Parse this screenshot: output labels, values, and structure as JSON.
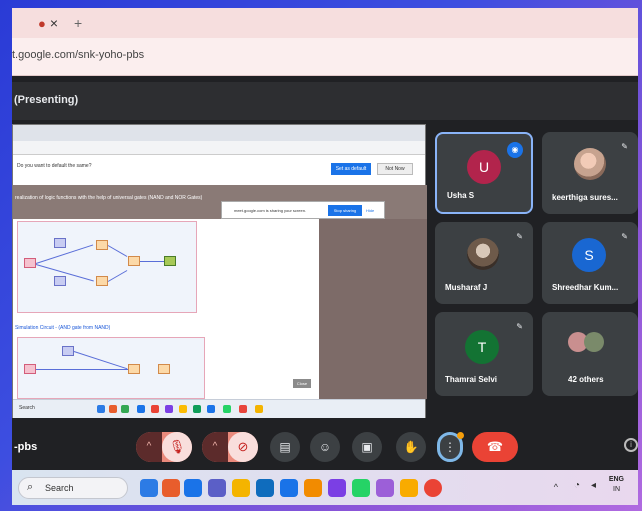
{
  "browser": {
    "tab_close": "×",
    "tab_controls": "●",
    "new_tab": "+",
    "url": "t.google.com/snk-yoho-pbs"
  },
  "meet": {
    "presenting_label": "(Presenting)",
    "meeting_code": "-pbs",
    "participants": [
      {
        "name": "Usha S",
        "initial": "U",
        "avatar_color": "#b2244c",
        "speaking": true
      },
      {
        "name": "keerthiga sures...",
        "initial": "",
        "photo": true
      },
      {
        "name": "Musharaf J",
        "initial": "",
        "photo": true
      },
      {
        "name": "Shreedhar Kum...",
        "initial": "S",
        "avatar_color": "#1967d2"
      },
      {
        "name": "Thamrai Selvi",
        "initial": "T",
        "avatar_color": "#137333"
      },
      {
        "name": "42 others",
        "initial": "",
        "group": true
      }
    ],
    "controls": {
      "caret": "^",
      "mic_icon": "🎙",
      "cam_icon": "⊘",
      "captions_icon": "▤",
      "emoji_icon": "☺",
      "present_icon": "▣",
      "raise_hand_icon": "✋",
      "more_icon": "⋮",
      "leave_icon": "☎",
      "info_icon": "i"
    }
  },
  "shared_screen": {
    "question": "Do you want to default the same?",
    "primary_btn": "Set as default",
    "secondary_btn": "Not Now",
    "heading": "realization of logic functions with the help of universal gates (NAND and NOR Gates)",
    "popup_text": "meet.google.com is sharing your screen.",
    "popup_stop": "Stop sharing",
    "popup_hide": "Hide",
    "caption": "Simulation Circuit - (AND gate from NAND)",
    "search": "Search",
    "close_tag": "Close"
  },
  "taskbar": {
    "search_label": "Search",
    "search_icon": "⌕",
    "chevron": "^",
    "lang_top": "ENG",
    "lang_bottom": "IN"
  },
  "colors": {
    "meet_bg": "#202124",
    "tile_bg": "#3c4043",
    "leave_red": "#ea4335",
    "active_outline": "#8ab4f8"
  }
}
